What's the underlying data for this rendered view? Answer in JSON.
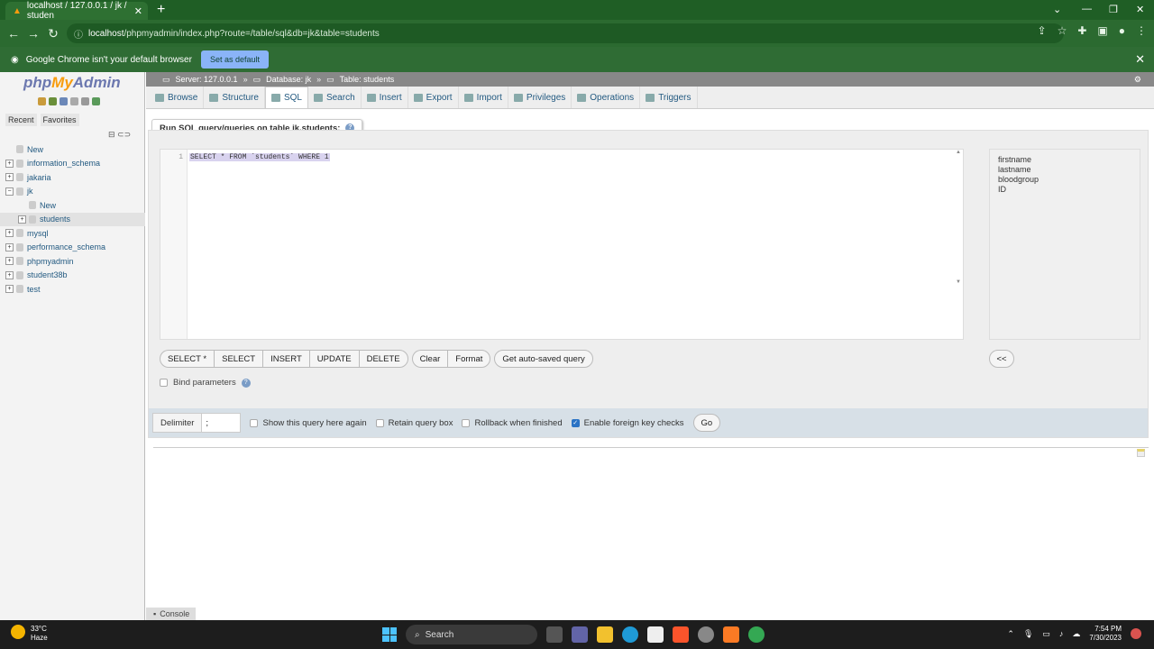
{
  "browser": {
    "tab_title": "localhost / 127.0.0.1 / jk / studen",
    "url_host": "localhost",
    "url_path": "/phpmyadmin/index.php?route=/table/sql&db=jk&table=students",
    "infobar_text": "Google Chrome isn't your default browser",
    "set_default_label": "Set as default"
  },
  "sidebar": {
    "logo_php": "php",
    "logo_my": "My",
    "logo_admin": "Admin",
    "tabs": [
      "Recent",
      "Favorites"
    ],
    "tree": [
      {
        "label": "New",
        "level": 1
      },
      {
        "label": "information_schema",
        "level": 1
      },
      {
        "label": "jakaria",
        "level": 1
      },
      {
        "label": "jk",
        "level": 1
      },
      {
        "label": "New",
        "level": 2
      },
      {
        "label": "students",
        "level": 2
      },
      {
        "label": "mysql",
        "level": 1
      },
      {
        "label": "performance_schema",
        "level": 1
      },
      {
        "label": "phpmyadmin",
        "level": 1
      },
      {
        "label": "student38b",
        "level": 1
      },
      {
        "label": "test",
        "level": 1
      }
    ]
  },
  "breadcrumb": {
    "server": "Server: 127.0.0.1",
    "database": "Database: jk",
    "table": "Table: students"
  },
  "tabs": [
    "Browse",
    "Structure",
    "SQL",
    "Search",
    "Insert",
    "Export",
    "Import",
    "Privileges",
    "Operations",
    "Triggers"
  ],
  "sql": {
    "legend": "Run SQL query/queries on table jk.students:",
    "line_number": "1",
    "query": "SELECT * FROM `students` WHERE 1",
    "columns": [
      "firstname",
      "lastname",
      "bloodgroup",
      "ID"
    ],
    "buttons": [
      "SELECT *",
      "SELECT",
      "INSERT",
      "UPDATE",
      "DELETE"
    ],
    "clear_label": "Clear",
    "format_label": "Format",
    "autosaved_label": "Get auto-saved query",
    "insert_col_label": "<<",
    "bind_label": "Bind parameters"
  },
  "options": {
    "delimiter_label": "Delimiter",
    "delimiter_value": ";",
    "show_again": "Show this query here again",
    "retain_box": "Retain query box",
    "rollback": "Rollback when finished",
    "foreign_keys": "Enable foreign key checks",
    "go_label": "Go"
  },
  "console_label": "Console",
  "taskbar": {
    "temp": "33°C",
    "condition": "Haze",
    "search": "Search",
    "time": "7:54 PM",
    "date": "7/30/2023"
  }
}
